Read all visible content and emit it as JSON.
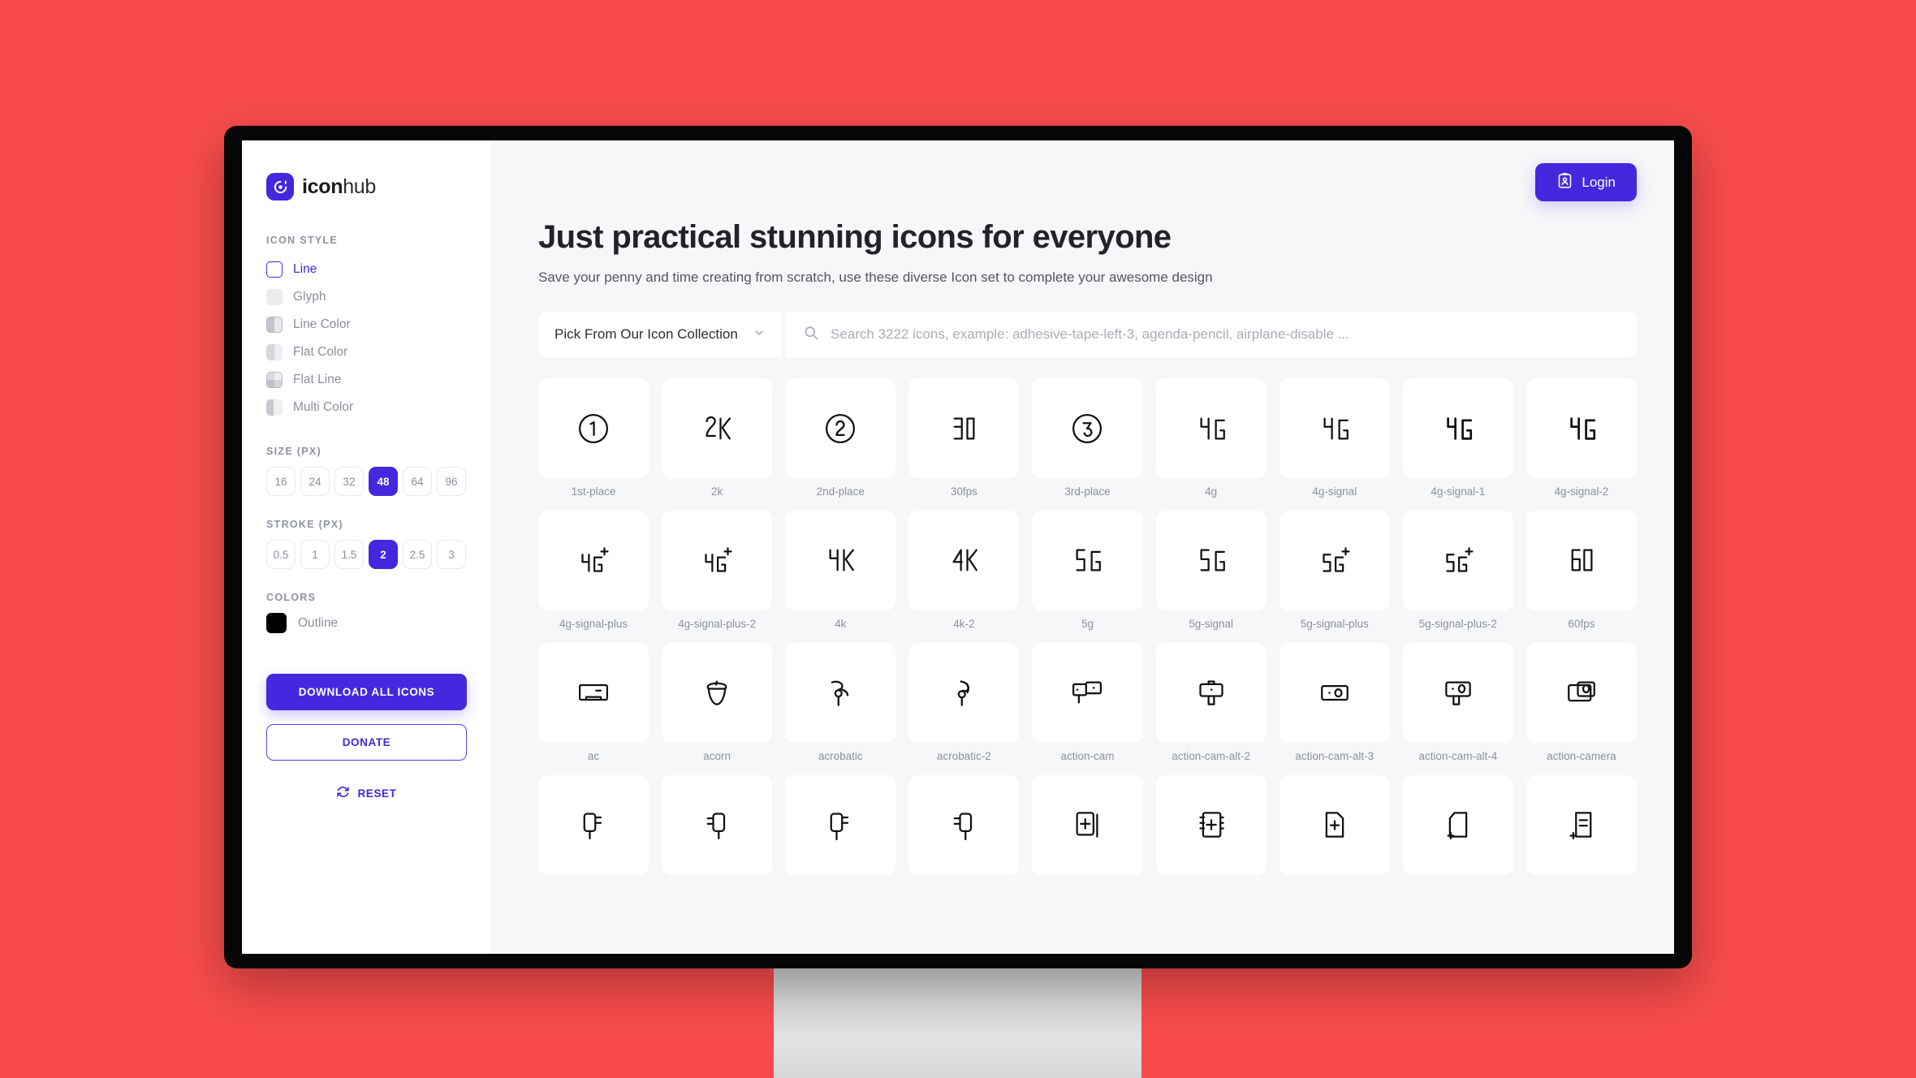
{
  "brand": {
    "name_bold": "icon",
    "name_light": "hub"
  },
  "sidebar": {
    "icon_style_title": "ICON STYLE",
    "styles": [
      {
        "label": "Line",
        "active": true
      },
      {
        "label": "Glyph",
        "active": false
      },
      {
        "label": "Line Color",
        "active": false
      },
      {
        "label": "Flat Color",
        "active": false
      },
      {
        "label": "Flat Line",
        "active": false
      },
      {
        "label": "Multi Color",
        "active": false
      }
    ],
    "size_title": "SIZE (PX)",
    "sizes": [
      "16",
      "24",
      "32",
      "48",
      "64",
      "96"
    ],
    "size_selected": "48",
    "stroke_title": "STROKE (PX)",
    "strokes": [
      "0.5",
      "1",
      "1.5",
      "2",
      "2.5",
      "3"
    ],
    "stroke_selected": "2",
    "colors_title": "COLORS",
    "color_name": "Outline",
    "color_value": "#000000",
    "download_label": "DOWNLOAD ALL ICONS",
    "donate_label": "DONATE",
    "reset_label": "RESET"
  },
  "header": {
    "login_label": "Login",
    "title": "Just practical stunning icons for everyone",
    "subtitle": "Save your penny and time creating from scratch, use these diverse Icon set to complete your awesome design"
  },
  "search": {
    "collection_value": "Pick From Our Icon Collection",
    "placeholder": "Search 3222 icons, example: adhesive-tape-left-3, agenda-pencil, airplane-disable ..."
  },
  "theme": {
    "accent": "#4527DE",
    "page_background": "#F74B4B",
    "screen_background": "#F6F7F9",
    "bezel": "#060606"
  },
  "icons": [
    {
      "label": "1st-place",
      "glyph": "circle-1"
    },
    {
      "label": "2k",
      "glyph": "text-2K"
    },
    {
      "label": "2nd-place",
      "glyph": "circle-2"
    },
    {
      "label": "30fps",
      "glyph": "text-30"
    },
    {
      "label": "3rd-place",
      "glyph": "circle-3"
    },
    {
      "label": "4g",
      "glyph": "text-4G"
    },
    {
      "label": "4g-signal",
      "glyph": "text-4G"
    },
    {
      "label": "4g-signal-1",
      "glyph": "text-4G"
    },
    {
      "label": "4g-signal-2",
      "glyph": "text-4G"
    },
    {
      "label": "4g-signal-plus",
      "glyph": "text-4G-plus"
    },
    {
      "label": "4g-signal-plus-2",
      "glyph": "text-4G-plus"
    },
    {
      "label": "4k",
      "glyph": "text-4K"
    },
    {
      "label": "4k-2",
      "glyph": "text-4K"
    },
    {
      "label": "5g",
      "glyph": "text-5G"
    },
    {
      "label": "5g-signal",
      "glyph": "text-5G"
    },
    {
      "label": "5g-signal-plus",
      "glyph": "text-5G-plus"
    },
    {
      "label": "5g-signal-plus-2",
      "glyph": "text-5G-plus"
    },
    {
      "label": "60fps",
      "glyph": "text-60"
    },
    {
      "label": "ac",
      "glyph": "ac-unit"
    },
    {
      "label": "acorn",
      "glyph": "acorn"
    },
    {
      "label": "acrobatic",
      "glyph": "acrobat"
    },
    {
      "label": "acrobatic-2",
      "glyph": "acrobat"
    },
    {
      "label": "action-cam",
      "glyph": "action-cam"
    },
    {
      "label": "action-cam-alt-2",
      "glyph": "action-cam-alt-2"
    },
    {
      "label": "action-cam-alt-3",
      "glyph": "action-cam-alt-3"
    },
    {
      "label": "action-cam-alt-4",
      "glyph": "action-cam-alt-4"
    },
    {
      "label": "action-camera",
      "glyph": "action-camera"
    },
    {
      "label": "",
      "glyph": "adapter-a"
    },
    {
      "label": "",
      "glyph": "adapter-b"
    },
    {
      "label": "",
      "glyph": "adapter-c"
    },
    {
      "label": "",
      "glyph": "adapter-d"
    },
    {
      "label": "",
      "glyph": "add-page-a"
    },
    {
      "label": "",
      "glyph": "add-notebook"
    },
    {
      "label": "",
      "glyph": "add-file"
    },
    {
      "label": "",
      "glyph": "add-card"
    },
    {
      "label": "",
      "glyph": "add-doc-lines"
    }
  ]
}
